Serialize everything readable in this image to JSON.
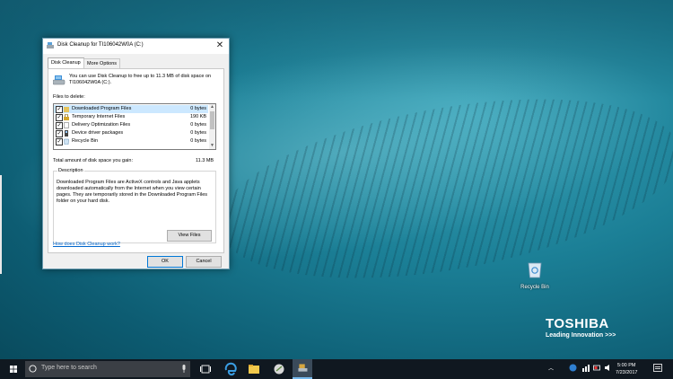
{
  "dialog": {
    "title": "Disk Cleanup for TI106042W0A (C:)",
    "tabs": [
      "Disk Cleanup",
      "More Options"
    ],
    "intro": "You can use Disk Cleanup to free up to 11.3 MB of disk space on TI106042W0A (C:).",
    "files_label": "Files to delete:",
    "files": [
      {
        "name": "Downloaded Program Files",
        "size": "0 bytes",
        "checked": true
      },
      {
        "name": "Temporary Internet Files",
        "size": "190 KB",
        "checked": true
      },
      {
        "name": "Delivery Optimization Files",
        "size": "0 bytes",
        "checked": true
      },
      {
        "name": "Device driver packages",
        "size": "0 bytes",
        "checked": true
      },
      {
        "name": "Recycle Bin",
        "size": "0 bytes",
        "checked": true
      }
    ],
    "total_label": "Total amount of disk space you gain:",
    "total_value": "11.3 MB",
    "description_title": "Description",
    "description": "Downloaded Program Files are ActiveX controls and Java applets downloaded automatically from the Internet when you view certain pages. They are temporarily stored in the Downloaded Program Files folder on your hard disk.",
    "view_files": "View Files",
    "help_link": "How does Disk Cleanup work?",
    "ok": "OK",
    "cancel": "Cancel"
  },
  "desktop": {
    "recycle_bin": "Recycle Bin",
    "brand_name": "TOSHIBA",
    "brand_tagline": "Leading Innovation >>>"
  },
  "taskbar": {
    "search_placeholder": "Type here to search",
    "time": "5:00 PM",
    "date": "7/23/2017"
  }
}
